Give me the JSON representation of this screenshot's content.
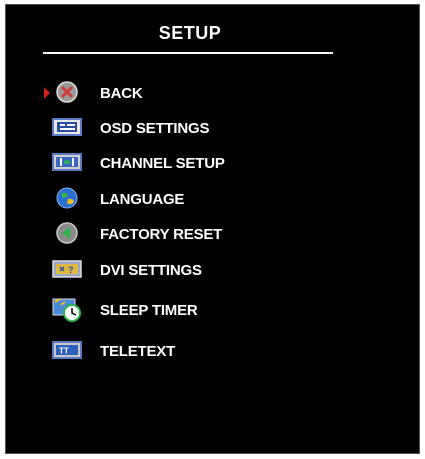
{
  "menu": {
    "title": "SETUP",
    "items": [
      {
        "label": "BACK",
        "icon": "back-icon",
        "selected": true
      },
      {
        "label": "OSD SETTINGS",
        "icon": "osd-settings-icon"
      },
      {
        "label": "CHANNEL SETUP",
        "icon": "channel-setup-icon"
      },
      {
        "label": "LANGUAGE",
        "icon": "globe-icon"
      },
      {
        "label": "FACTORY RESET",
        "icon": "reset-icon"
      },
      {
        "label": "DVI SETTINGS",
        "icon": "dvi-settings-icon"
      },
      {
        "label": "SLEEP TIMER",
        "icon": "clock-icon"
      },
      {
        "label": "TELETEXT",
        "icon": "teletext-icon"
      }
    ]
  },
  "colors": {
    "background": "#000000",
    "text": "#ffffff",
    "selection_arrow": "#d02020"
  }
}
